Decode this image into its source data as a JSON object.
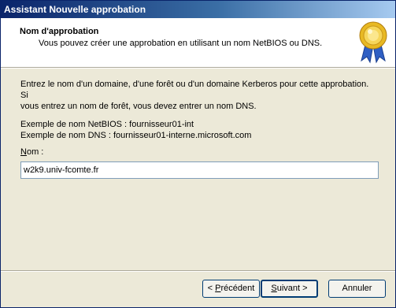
{
  "window": {
    "title": "Assistant Nouvelle approbation"
  },
  "header": {
    "title": "Nom d'approbation",
    "subtitle": "Vous pouvez créer une approbation en utilisant un nom NetBIOS ou DNS.",
    "icon": "certificate-seal-icon"
  },
  "body": {
    "instruction_line1": "Entrez le nom d'un domaine, d'une forêt ou d'un domaine Kerberos pour cette approbation. Si",
    "instruction_line2": "vous entrez un nom de forêt, vous devez entrer un nom DNS.",
    "example_netbios": "Exemple de nom NetBIOS : fournisseur01-int",
    "example_dns": "Exemple de nom DNS : fournisseur01-interne.microsoft.com",
    "name_label_mnemonic": "N",
    "name_label_rest": "om :",
    "name_value": "w2k9.univ-fcomte.fr"
  },
  "buttons": {
    "back_prefix": "< ",
    "back_mnemonic": "P",
    "back_rest": "récédent",
    "next_mnemonic": "S",
    "next_rest": "uivant >",
    "cancel": "Annuler"
  }
}
